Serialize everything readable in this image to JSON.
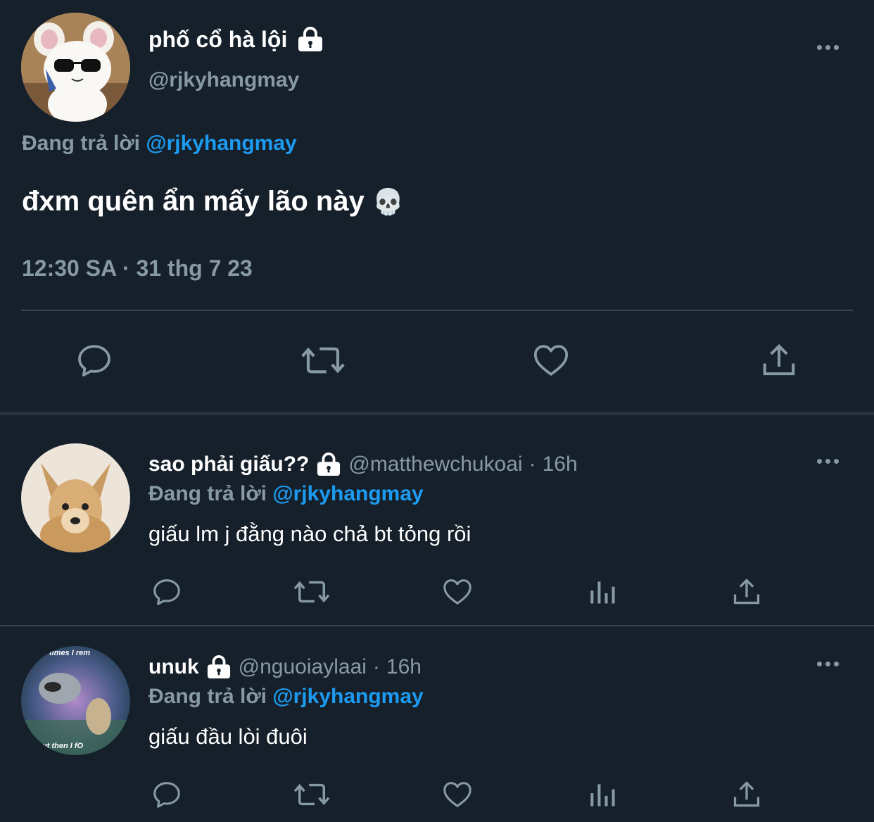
{
  "main_tweet": {
    "display_name": "phố cổ hà lội",
    "handle": "@rjkyhangmay",
    "replying_prefix": "Đang trả lời",
    "replying_to": "@rjkyhangmay",
    "text": "đxm quên ẩn mấy lão này",
    "emoji": "💀",
    "timestamp": "12:30 SA · 31 thg 7 23"
  },
  "replies": [
    {
      "display_name": "sao phải giấu??",
      "handle": "@matthewchukoai",
      "dot": "·",
      "time": "16h",
      "replying_prefix": "Đang trả lời",
      "replying_to": "@rjkyhangmay",
      "text": "giấu lm j đằng nào chả bt tỏng rồi"
    },
    {
      "display_name": "unuk",
      "handle": "@nguoiaylaai",
      "dot": "·",
      "time": "16h",
      "replying_prefix": "Đang trả lời",
      "replying_to": "@rjkyhangmay",
      "text": "giấu đầu lòi đuôi",
      "avatar_caption_top": "times I rem",
      "avatar_caption_bottom": "ut then I fO"
    }
  ],
  "icons": [
    "lock-icon",
    "more-icon",
    "reply-icon",
    "retweet-icon",
    "like-icon",
    "share-icon",
    "views-icon"
  ],
  "colors": {
    "background": "#15202b",
    "muted": "#8899a6",
    "link": "#1d9bf0",
    "divider": "#38444d"
  }
}
